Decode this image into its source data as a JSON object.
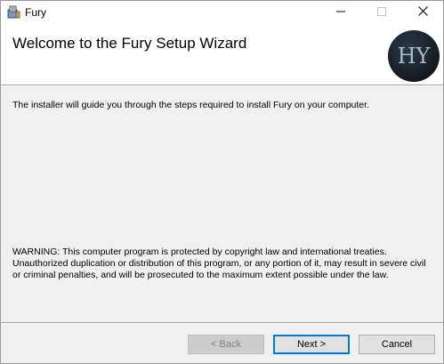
{
  "window": {
    "title": "Fury",
    "icons": {
      "app": "installer-box-icon",
      "minimize": "minimize-icon",
      "maximize": "maximize-icon",
      "close": "close-icon"
    }
  },
  "header": {
    "title": "Welcome to the Fury Setup Wizard",
    "logo_text": "HY"
  },
  "body": {
    "intro": "The installer will guide you through the steps required to install Fury on your computer.",
    "warning_lines": [
      "WARNING: This computer program is protected by copyright law and international treaties.",
      "Unauthorized duplication or distribution of this program, or any portion of it, may result in severe civil",
      "or criminal penalties, and will be prosecuted to the maximum extent possible under the law."
    ]
  },
  "buttons": {
    "back": "< Back",
    "next": "Next >",
    "cancel": "Cancel"
  },
  "colors": {
    "accent": "#0078d7",
    "logo_bg": "#141c24"
  }
}
